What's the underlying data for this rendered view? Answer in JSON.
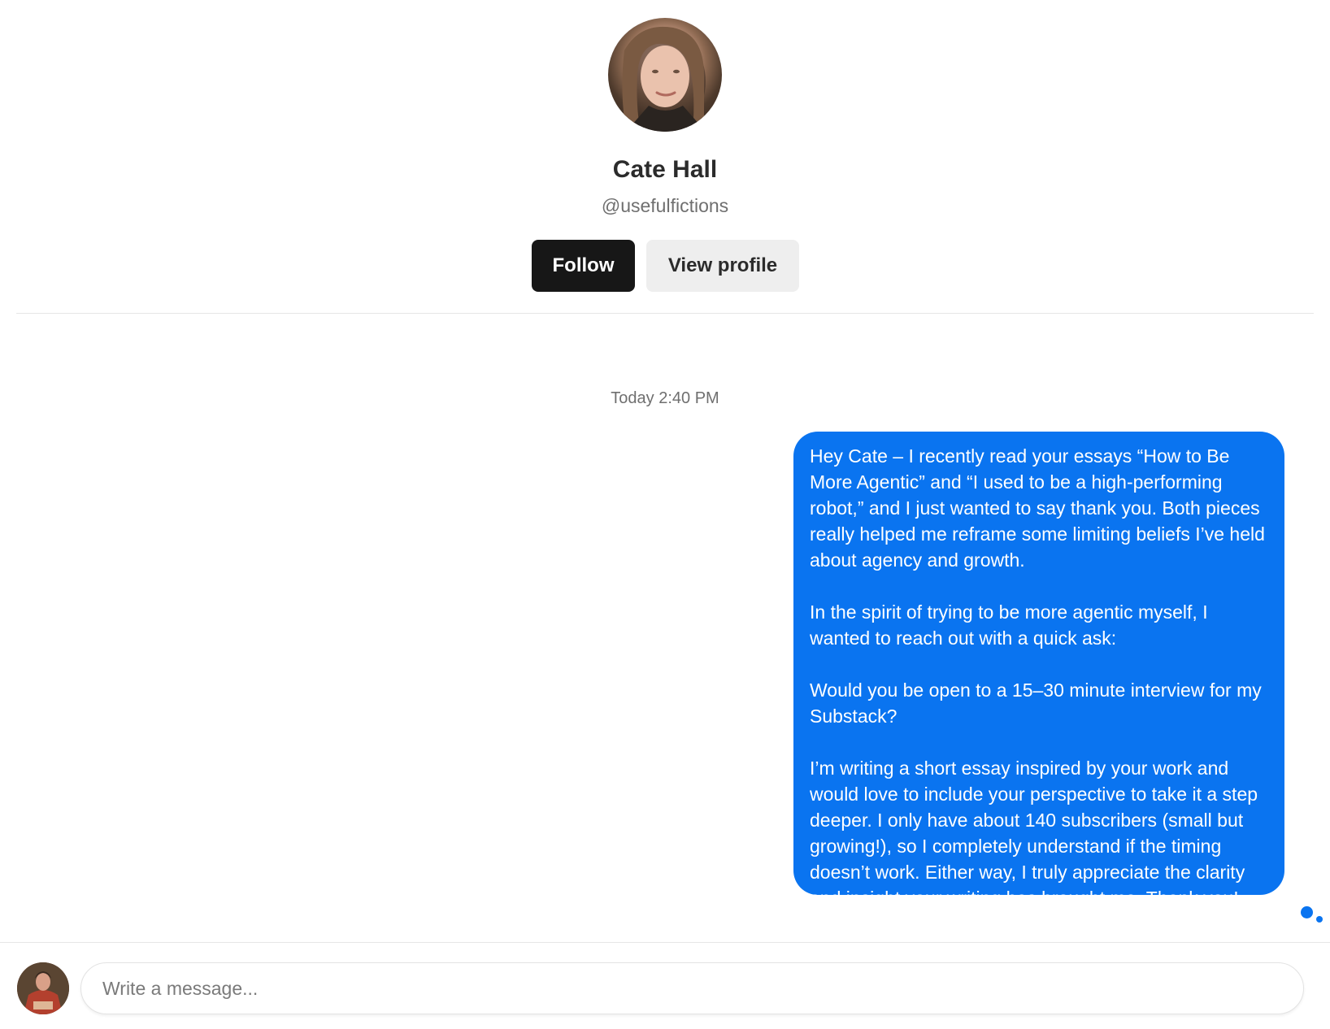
{
  "profile": {
    "name": "Cate Hall",
    "handle": "@usefulfictions",
    "follow_label": "Follow",
    "view_profile_label": "View profile"
  },
  "conversation": {
    "timestamp": "Today 2:40 PM",
    "messages": [
      {
        "direction": "outgoing",
        "paragraphs": [
          "Hey Cate – I recently read your essays “How to Be More Agentic” and “I used to be a high-performing robot,” and I just wanted to say thank you. Both pieces really helped me reframe some limiting beliefs I’ve held about agency and growth.",
          "In the spirit of trying to be more agentic myself, I wanted to reach out with a quick ask:",
          "Would you be open to a 15–30 minute interview for my Substack?",
          "I’m writing a short essay inspired by your work and would love to include your perspective to take it a step deeper. I only have about 140 subscribers (small but growing!), so I completely understand if the timing doesn’t work. Either way, I truly appreciate the clarity and insight your writing has brought me. Thank you!"
        ]
      }
    ]
  },
  "composer": {
    "placeholder": "Write a message...",
    "value": ""
  },
  "colors": {
    "bubble": "#0a74f0",
    "follow_button": "#171717",
    "view_profile_button": "#eeeeee"
  }
}
